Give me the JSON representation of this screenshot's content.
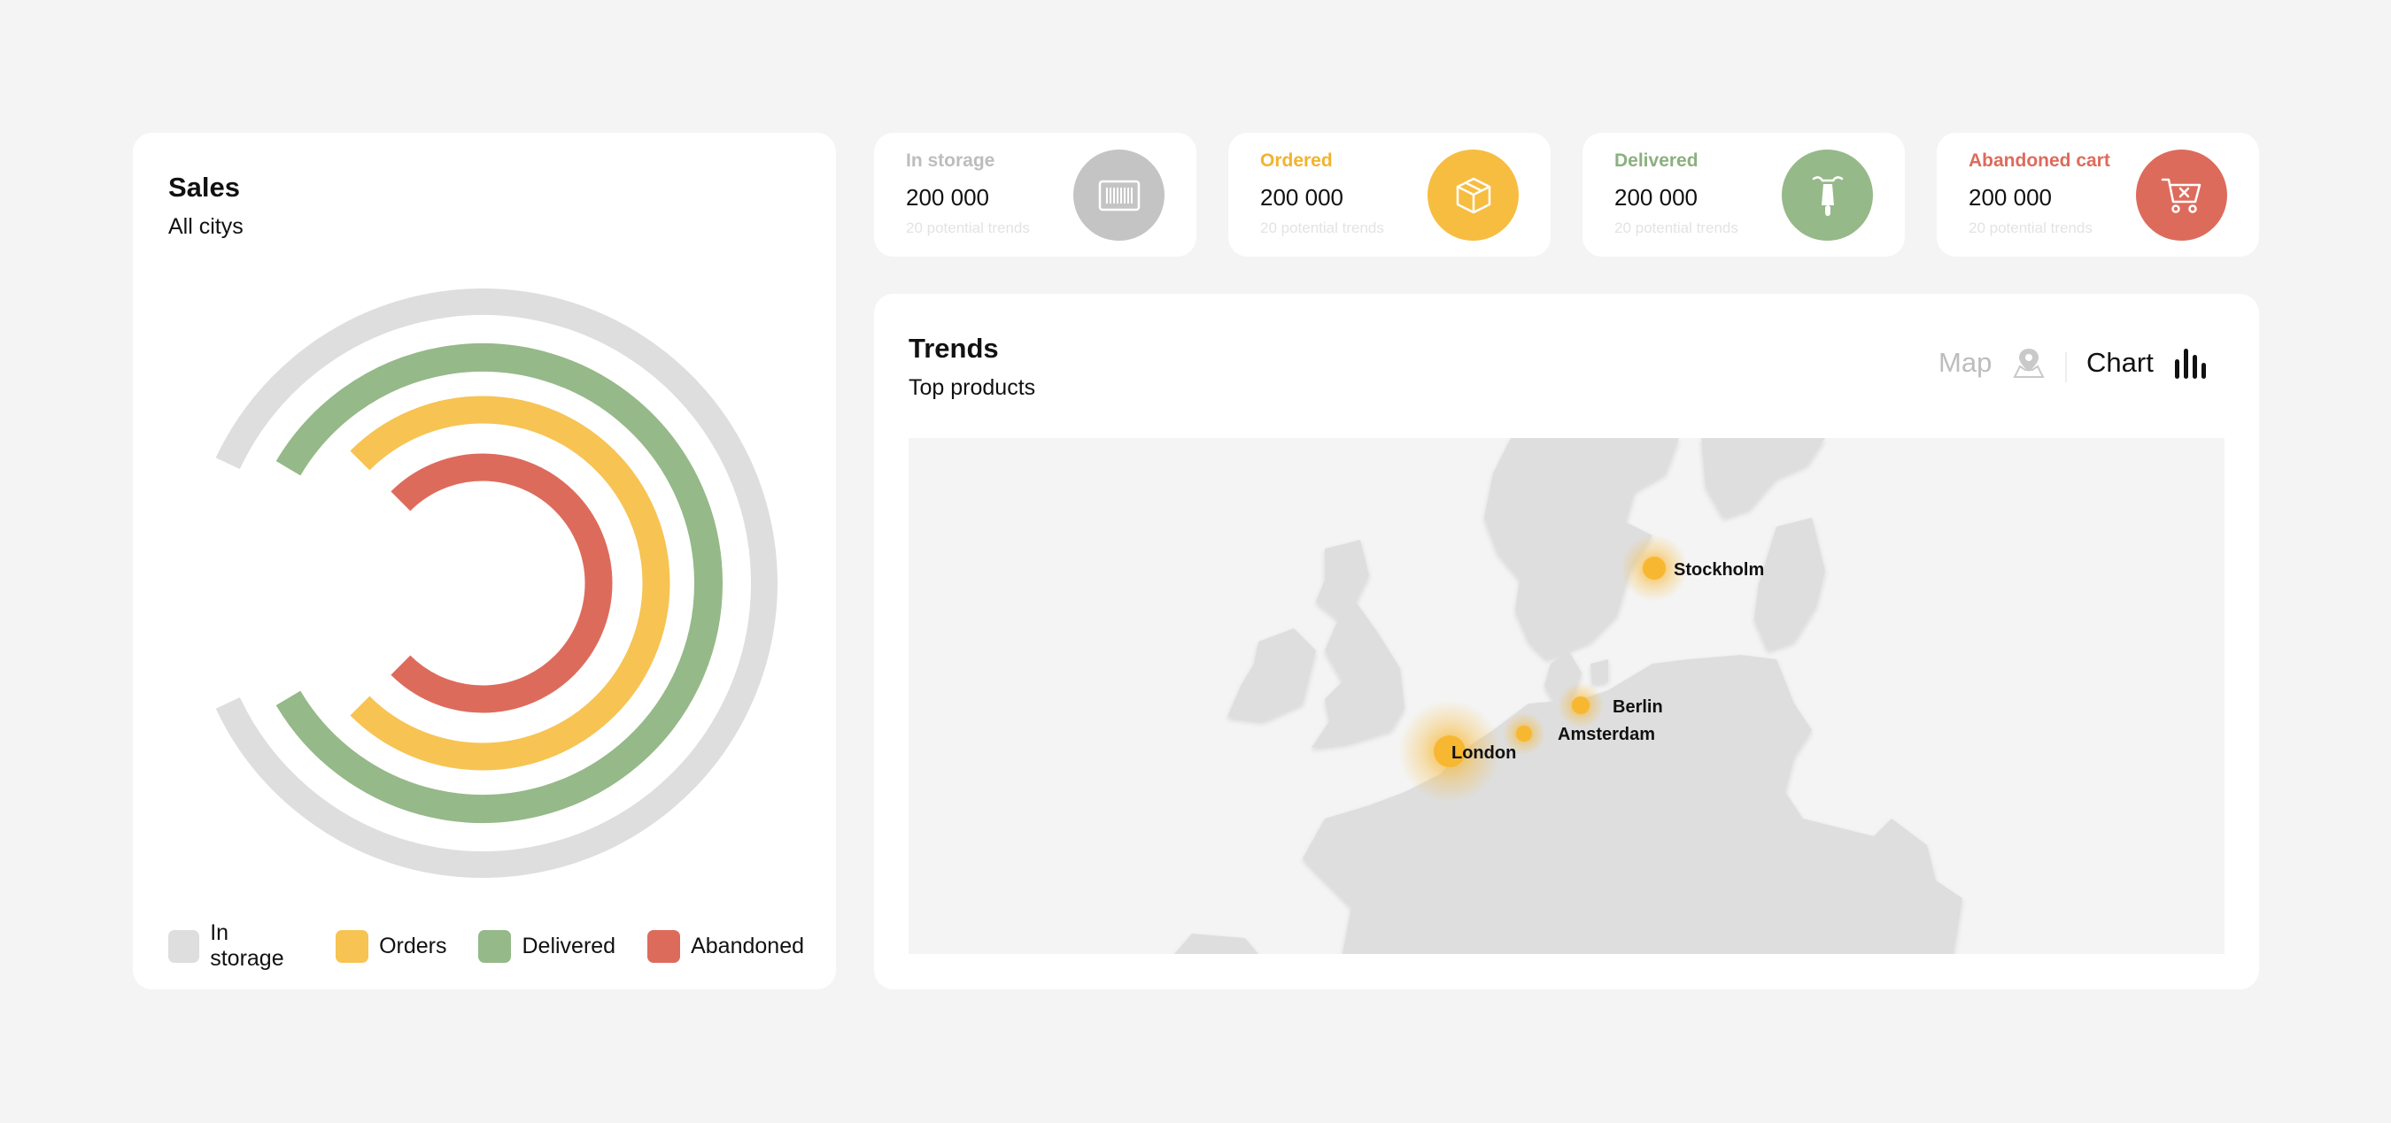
{
  "sales": {
    "title": "Sales",
    "subtitle": "All citys",
    "rings": [
      {
        "name": "In storage",
        "color": "#dedede",
        "fraction": 0.86
      },
      {
        "name": "Delivered",
        "color": "#95b988",
        "fraction": 0.83
      },
      {
        "name": "Orders",
        "color": "#f7c353",
        "fraction": 0.75
      },
      {
        "name": "Abandoned",
        "color": "#dd6b5c",
        "fraction": 0.75
      }
    ],
    "legend": [
      {
        "label": "In storage",
        "color": "#dedede"
      },
      {
        "label": "Orders",
        "color": "#f7c353"
      },
      {
        "label": "Delivered",
        "color": "#95b988"
      },
      {
        "label": "Abandoned",
        "color": "#dd6b5c"
      }
    ]
  },
  "stats": [
    {
      "label": "In storage",
      "value": "200 000",
      "sub": "20 potential trends",
      "color": "#bdbdbd",
      "badge_color": "#c4c4c4",
      "icon": "barcode-icon"
    },
    {
      "label": "Ordered",
      "value": "200 000",
      "sub": "20 potential trends",
      "color": "#f2b32d",
      "badge_color": "#f7bd41",
      "icon": "box-icon"
    },
    {
      "label": "Delivered",
      "value": "200 000",
      "sub": "20 potential trends",
      "color": "#8bb07e",
      "badge_color": "#95b988",
      "icon": "scooter-icon"
    },
    {
      "label": "Abandoned cart",
      "value": "200 000",
      "sub": "20 potential trends",
      "color": "#dd6b5c",
      "badge_color": "#dd6b5c",
      "icon": "cart-x-icon"
    }
  ],
  "trends": {
    "title": "Trends",
    "subtitle": "Top products",
    "toggle": {
      "map_label": "Map",
      "chart_label": "Chart"
    },
    "cities": [
      {
        "name": "Stockholm"
      },
      {
        "name": "Berlin"
      },
      {
        "name": "Amsterdam"
      },
      {
        "name": "London"
      }
    ]
  }
}
